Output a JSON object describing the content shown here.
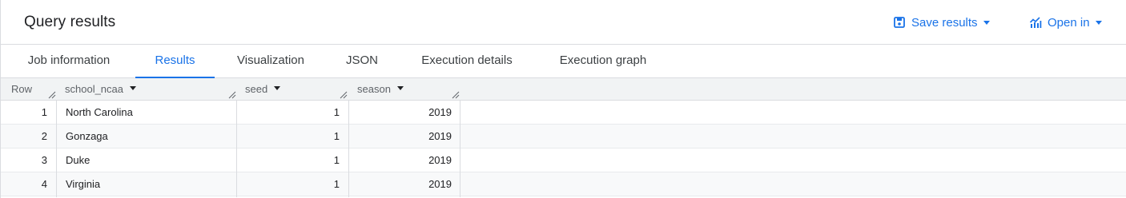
{
  "header": {
    "title": "Query results",
    "save_label": "Save results",
    "open_label": "Open in"
  },
  "tabs": [
    {
      "label": "Job information",
      "active": false
    },
    {
      "label": "Results",
      "active": true
    },
    {
      "label": "Visualization",
      "active": false
    },
    {
      "label": "JSON",
      "active": false
    },
    {
      "label": "Execution details",
      "active": false
    },
    {
      "label": "Execution graph",
      "active": false
    }
  ],
  "table": {
    "columns": [
      "Row",
      "school_ncaa",
      "seed",
      "season"
    ],
    "rows": [
      {
        "row": "1",
        "school_ncaa": "North Carolina",
        "seed": "1",
        "season": "2019"
      },
      {
        "row": "2",
        "school_ncaa": "Gonzaga",
        "seed": "1",
        "season": "2019"
      },
      {
        "row": "3",
        "school_ncaa": "Duke",
        "seed": "1",
        "season": "2019"
      },
      {
        "row": "4",
        "school_ncaa": "Virginia",
        "seed": "1",
        "season": "2019"
      }
    ]
  },
  "colors": {
    "accent": "#1a73e8",
    "border": "#dadce0",
    "header_bg": "#f1f3f4"
  }
}
